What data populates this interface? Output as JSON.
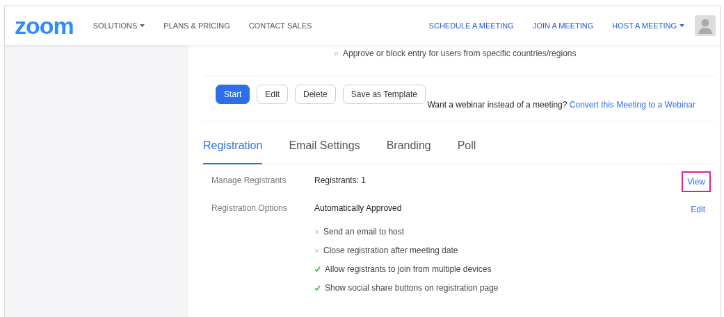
{
  "header": {
    "logo": "zoom",
    "nav_left": [
      {
        "label": "SOLUTIONS",
        "dropdown": true
      },
      {
        "label": "PLANS & PRICING",
        "dropdown": false
      },
      {
        "label": "CONTACT SALES",
        "dropdown": false
      }
    ],
    "nav_right": [
      {
        "label": "SCHEDULE A MEETING",
        "dropdown": false
      },
      {
        "label": "JOIN A MEETING",
        "dropdown": false
      },
      {
        "label": "HOST A MEETING",
        "dropdown": true
      }
    ]
  },
  "top_option": {
    "text": "Approve or block entry for users from specific countries/regions",
    "checked": false
  },
  "actions": [
    {
      "label": "Start",
      "primary": true
    },
    {
      "label": "Edit",
      "primary": false
    },
    {
      "label": "Delete",
      "primary": false
    },
    {
      "label": "Save as Template",
      "primary": false
    }
  ],
  "webinar": {
    "text": "Want a webinar instead of a meeting?",
    "link": "Convert this Meeting to a Webinar"
  },
  "tabs": [
    {
      "label": "Registration",
      "selected": true
    },
    {
      "label": "Email Settings",
      "selected": false
    },
    {
      "label": "Branding",
      "selected": false
    },
    {
      "label": "Poll",
      "selected": false
    }
  ],
  "rows": [
    {
      "label": "Manage Registrants",
      "value": "Registrants: 1",
      "action": "View",
      "highlighted": true,
      "options": []
    },
    {
      "label": "Registration Options",
      "value": "Automatically Approved",
      "action": "Edit",
      "highlighted": false,
      "options": [
        {
          "text": "Send an email to host",
          "checked": false
        },
        {
          "text": "Close registration after meeting date",
          "checked": false
        },
        {
          "text": "Allow registrants to join from multiple devices",
          "checked": true
        },
        {
          "text": "Show social share buttons on registration page",
          "checked": true
        }
      ]
    }
  ]
}
